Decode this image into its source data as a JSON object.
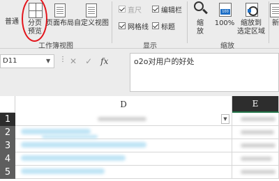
{
  "ribbon": {
    "view_group": {
      "normal": "普通",
      "page_break_line1": "分页",
      "page_break_line2": "预览",
      "page_layout": "页面布局",
      "custom_views": "自定义视图",
      "label": "工作簿视图"
    },
    "show_group": {
      "ruler": "直尺",
      "formula_bar": "编辑栏",
      "gridlines": "网格线",
      "headings": "标题",
      "label": "显示"
    },
    "zoom_group": {
      "zoom_line1": "缩",
      "zoom_line2": "放",
      "zoom100": "100%",
      "zoom_selection_line1": "缩放到",
      "zoom_selection_line2": "选定区域",
      "label": "缩放"
    },
    "new_window_partial": "新"
  },
  "formula_bar": {
    "name_box": "D11",
    "cancel_icon": "✕",
    "enter_icon": "✓",
    "fx_label": "fx",
    "content": "o2o对用户的好处"
  },
  "grid": {
    "columns": [
      "D",
      "E"
    ],
    "rows": [
      "1",
      "2",
      "3",
      "4",
      "5"
    ]
  },
  "colors": {
    "ribbon_bg": "#ececec",
    "highlight_oval": "#e3141b",
    "selected_header": "#2d2d2d"
  }
}
